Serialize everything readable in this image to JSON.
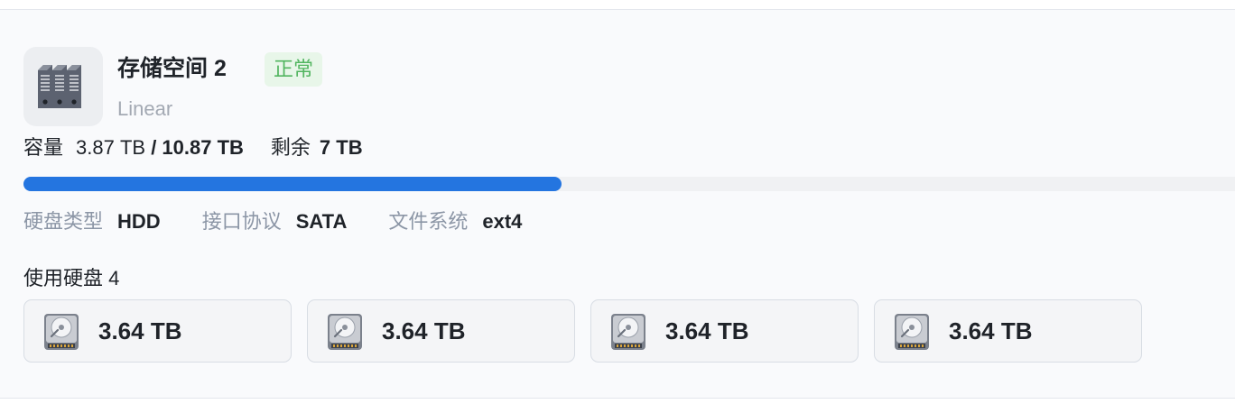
{
  "pool": {
    "name": "存储空间 2",
    "status": "正常",
    "type": "Linear",
    "icon": "storage-pool-icon",
    "colors": {
      "status_bg": "#e8f6e9",
      "status_text": "#52b560",
      "progress": "#2475e0"
    }
  },
  "capacity": {
    "label": "容量",
    "used": "3.87 TB",
    "total": "/ 10.87 TB",
    "remaining_label": "剩余",
    "remaining": "7 TB",
    "used_fraction": 0.444
  },
  "meta": {
    "disk_type_label": "硬盘类型",
    "disk_type": "HDD",
    "interface_label": "接口协议",
    "interface": "SATA",
    "filesystem_label": "文件系统",
    "filesystem": "ext4"
  },
  "disks": {
    "title": "使用硬盘 4",
    "items": [
      {
        "size": "3.64 TB",
        "icon": "hdd-icon"
      },
      {
        "size": "3.64 TB",
        "icon": "hdd-icon"
      },
      {
        "size": "3.64 TB",
        "icon": "hdd-icon"
      },
      {
        "size": "3.64 TB",
        "icon": "hdd-icon"
      }
    ]
  }
}
